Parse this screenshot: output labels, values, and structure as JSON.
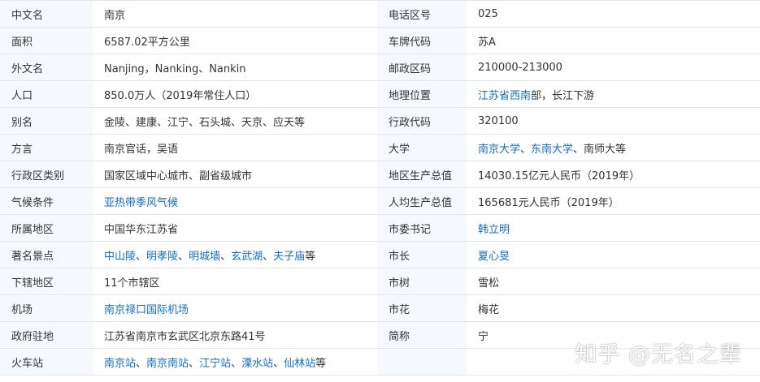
{
  "colors": {
    "key_bg": "#f5f8fc",
    "text": "#333333",
    "link": "#136ec2",
    "border": "#e6e6e6"
  },
  "rows": [
    {
      "l": {
        "key": "中文名",
        "value": [
          {
            "t": "南京",
            "link": false
          }
        ]
      },
      "r": {
        "key": "电话区号",
        "value": [
          {
            "t": "025",
            "link": false
          }
        ]
      }
    },
    {
      "l": {
        "key": "面积",
        "value": [
          {
            "t": "6587.02平方公里",
            "link": false
          }
        ]
      },
      "r": {
        "key": "车牌代码",
        "value": [
          {
            "t": "苏A",
            "link": false
          }
        ]
      }
    },
    {
      "l": {
        "key": "外文名",
        "value": [
          {
            "t": "Nanjing，Nanking、Nankin",
            "link": false
          }
        ]
      },
      "r": {
        "key": "邮政区码",
        "value": [
          {
            "t": "210000-213000",
            "link": false
          }
        ]
      }
    },
    {
      "l": {
        "key": "人口",
        "value": [
          {
            "t": "850.0万人（2019年常住人口）",
            "link": false
          }
        ]
      },
      "r": {
        "key": "地理位置",
        "value": [
          {
            "t": "江苏省西南",
            "link": true
          },
          {
            "t": "部，长江下游",
            "link": false
          }
        ]
      }
    },
    {
      "l": {
        "key": "别名",
        "value": [
          {
            "t": "金陵、建康、江宁、石头城、天京、应天等",
            "link": false
          }
        ]
      },
      "r": {
        "key": "行政代码",
        "value": [
          {
            "t": "320100",
            "link": false
          }
        ]
      }
    },
    {
      "l": {
        "key": "方言",
        "value": [
          {
            "t": "南京官话，吴语",
            "link": false
          }
        ]
      },
      "r": {
        "key": "大学",
        "value": [
          {
            "t": "南京大学",
            "link": true
          },
          {
            "t": "、",
            "link": false
          },
          {
            "t": "东南大学",
            "link": true
          },
          {
            "t": "、南师大等",
            "link": false
          }
        ]
      }
    },
    {
      "l": {
        "key": "行政区类别",
        "value": [
          {
            "t": "国家区域中心城市、副省级城市",
            "link": false
          }
        ]
      },
      "r": {
        "key": "地区生产总值",
        "value": [
          {
            "t": "14030.15亿元人民币（2019年）",
            "link": false
          }
        ]
      }
    },
    {
      "l": {
        "key": "气候条件",
        "value": [
          {
            "t": "亚热带季风气候",
            "link": true
          }
        ]
      },
      "r": {
        "key": "人均生产总值",
        "value": [
          {
            "t": "165681元人民币（2019年）",
            "link": false
          }
        ]
      }
    },
    {
      "l": {
        "key": "所属地区",
        "value": [
          {
            "t": "中国华东江苏省",
            "link": false
          }
        ]
      },
      "r": {
        "key": "市委书记",
        "value": [
          {
            "t": "韩立明",
            "link": true
          }
        ]
      }
    },
    {
      "l": {
        "key": "著名景点",
        "value": [
          {
            "t": "中山陵",
            "link": true
          },
          {
            "t": "、",
            "link": false
          },
          {
            "t": "明孝陵",
            "link": true
          },
          {
            "t": "、",
            "link": false
          },
          {
            "t": "明城墙",
            "link": true
          },
          {
            "t": "、",
            "link": false
          },
          {
            "t": "玄武湖",
            "link": true
          },
          {
            "t": "、",
            "link": false
          },
          {
            "t": "夫子庙",
            "link": true
          },
          {
            "t": "等",
            "link": false
          }
        ]
      },
      "r": {
        "key": "市长",
        "value": [
          {
            "t": "夏心旻",
            "link": true
          }
        ]
      }
    },
    {
      "l": {
        "key": "下辖地区",
        "value": [
          {
            "t": "11个市辖区",
            "link": false
          }
        ]
      },
      "r": {
        "key": "市树",
        "value": [
          {
            "t": "雪松",
            "link": false
          }
        ]
      }
    },
    {
      "l": {
        "key": "机场",
        "value": [
          {
            "t": "南京禄口国际机场",
            "link": true
          }
        ]
      },
      "r": {
        "key": "市花",
        "value": [
          {
            "t": "梅花",
            "link": false
          }
        ]
      }
    },
    {
      "l": {
        "key": "政府驻地",
        "value": [
          {
            "t": "江苏省南京市玄武区北京东路41号",
            "link": false
          }
        ]
      },
      "r": {
        "key": "简称",
        "value": [
          {
            "t": "宁",
            "link": false
          }
        ]
      }
    },
    {
      "l": {
        "key": "火车站",
        "value": [
          {
            "t": "南京站",
            "link": true
          },
          {
            "t": "、",
            "link": false
          },
          {
            "t": "南京南站",
            "link": true
          },
          {
            "t": "、",
            "link": false
          },
          {
            "t": "江宁站",
            "link": true
          },
          {
            "t": "、",
            "link": false
          },
          {
            "t": "溧水站",
            "link": true
          },
          {
            "t": "、",
            "link": false
          },
          {
            "t": "仙林站",
            "link": true
          },
          {
            "t": "等",
            "link": false
          }
        ]
      },
      "r": {
        "key": "",
        "value": []
      }
    }
  ],
  "watermark": "知乎 @无名之辈"
}
